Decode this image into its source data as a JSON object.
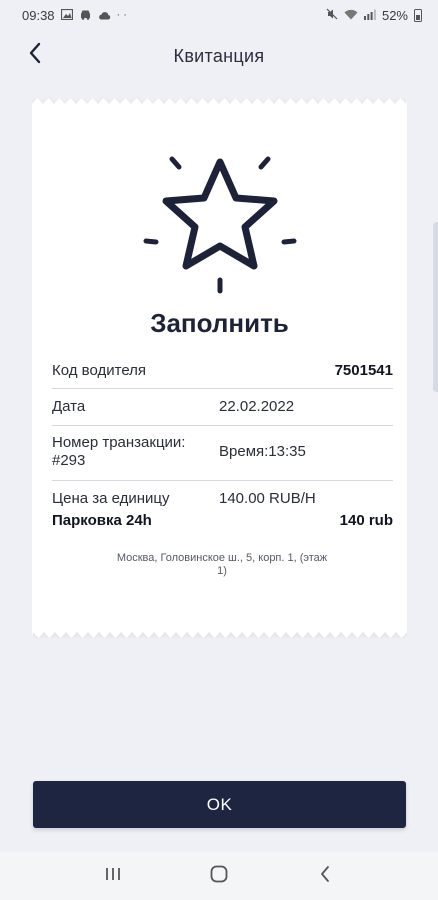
{
  "status_bar": {
    "time": "09:38",
    "dots": "· ·",
    "battery_text": "52%"
  },
  "header": {
    "title": "Квитанция"
  },
  "receipt": {
    "heading": "Заполнить",
    "driver_code_label": "Код водителя",
    "driver_code_value": "7501541",
    "date_label": "Дата",
    "date_value": "22.02.2022",
    "transaction_label_line1": "Номер транзакции:",
    "transaction_label_line2": "#293",
    "time_value": "Время:13:35",
    "unit_price_label": "Цена за единицу",
    "unit_price_value": "140.00 RUB/H",
    "service_label": "Парковка 24h",
    "service_total": "140 rub",
    "address_line1": "Москва, Головинское ш., 5, корп. 1, (этаж",
    "address_line2": "1)"
  },
  "actions": {
    "ok_label": "OK"
  },
  "colors": {
    "background": "#eff0f6",
    "primary_dark": "#1e2541",
    "receipt_paper": "#ffffff"
  },
  "icons": {
    "header_back": "chevron-left-icon",
    "receipt_graphic": "star-icon",
    "nav_recents": "recents-icon",
    "nav_home": "home-icon",
    "nav_back": "back-icon"
  }
}
